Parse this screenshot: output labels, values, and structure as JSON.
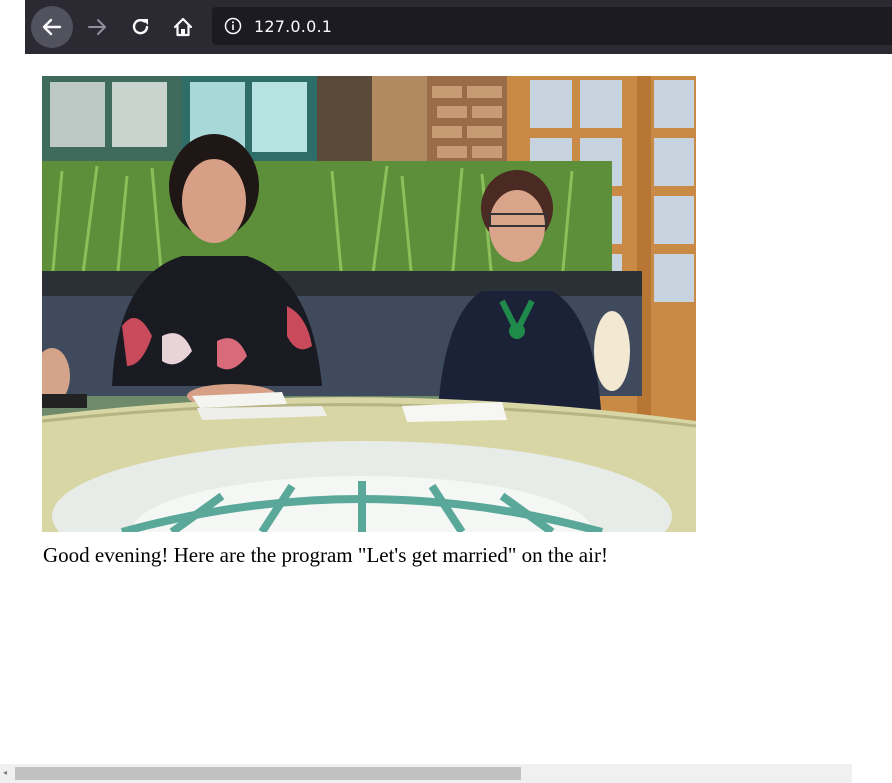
{
  "browser": {
    "url": "127.0.0.1",
    "icons": {
      "back": "arrow-left-icon",
      "forward": "arrow-right-icon",
      "reload": "reload-icon",
      "home": "home-icon",
      "site_info": "info-icon"
    },
    "colors": {
      "toolbar": "#2b2a33",
      "urlbar": "#1c1b22"
    }
  },
  "page": {
    "caption": "Good evening! Here are the program \"Let's get married\" on the air!"
  }
}
